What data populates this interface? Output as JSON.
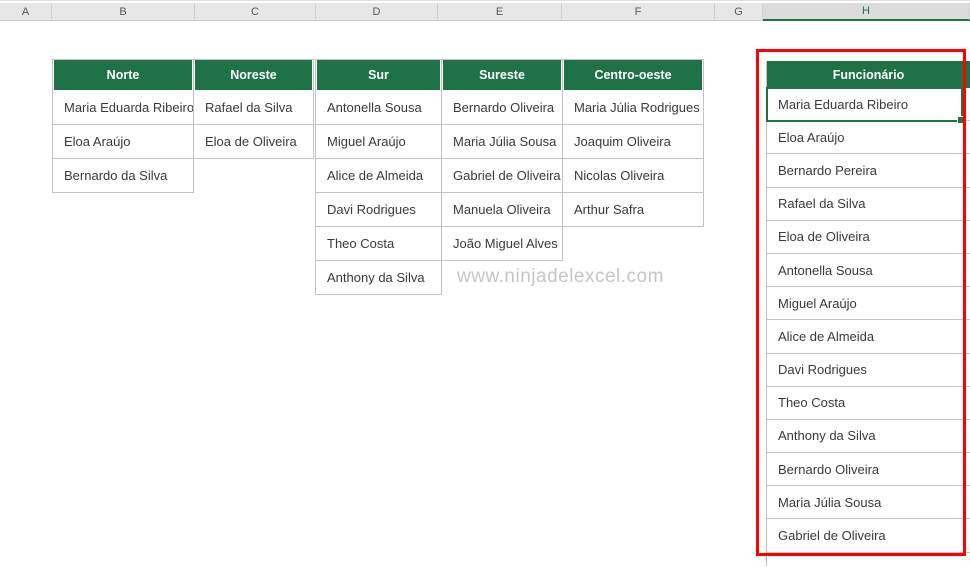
{
  "column_strip": {
    "letters": [
      "A",
      "B",
      "C",
      "D",
      "E",
      "F",
      "G",
      "H"
    ],
    "selected": "H"
  },
  "region_tables": [
    {
      "header": "Norte",
      "rows": [
        "Maria Eduarda Ribeiro",
        "Eloa Araújo",
        "Bernardo da Silva"
      ]
    },
    {
      "header": "Noreste",
      "rows": [
        "Rafael da Silva",
        "Eloa de Oliveira"
      ]
    },
    {
      "header": "Sur",
      "rows": [
        "Antonella Sousa",
        "Miguel Araújo",
        "Alice de Almeida",
        "Davi Rodrigues",
        "Theo Costa",
        "Anthony da Silva"
      ]
    },
    {
      "header": "Sureste",
      "rows": [
        "Bernardo Oliveira",
        "Maria Júlia Sousa",
        "Gabriel de Oliveira",
        "Manuela Oliveira",
        "João Miguel Alves"
      ]
    },
    {
      "header": "Centro-oeste",
      "rows": [
        "Maria Júlia Rodrigues",
        "Joaquim Oliveira",
        "Nicolas Oliveira",
        "Arthur Safra"
      ]
    }
  ],
  "employee_table": {
    "header": "Funcionário",
    "active_row": "Maria Eduarda Ribeiro",
    "rows": [
      "Maria Eduarda Ribeiro",
      "Eloa Araújo",
      "Bernardo Pereira",
      "Rafael da Silva",
      "Eloa de Oliveira",
      "Antonella Sousa",
      "Miguel Araújo",
      "Alice de Almeida",
      "Davi Rodrigues",
      "Theo Costa",
      "Anthony da Silva",
      "Bernardo Oliveira",
      "Maria Júlia Sousa",
      "Gabriel de Oliveira"
    ]
  },
  "watermark": "www.ninjadelexcel.com",
  "colors": {
    "table_header_green": "#1f7246",
    "selection_green": "#217346",
    "highlight_red": "#ff0000",
    "grid_border": "#c3c3c3"
  }
}
